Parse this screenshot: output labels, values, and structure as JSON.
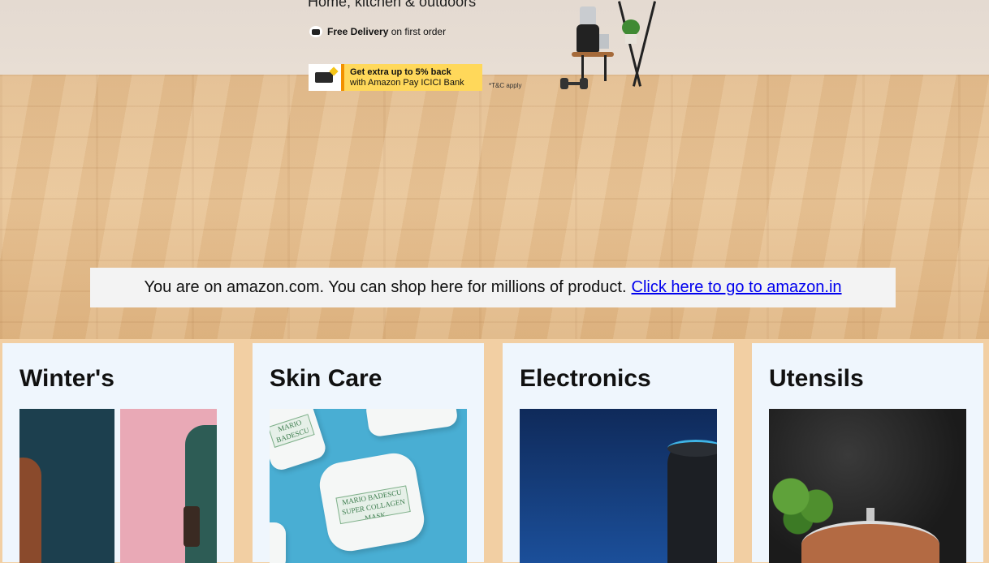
{
  "hero": {
    "subtitle": "Home, kitchen & outdoors",
    "delivery_bold": "Free Delivery",
    "delivery_rest": "on first order",
    "offer_line1": "Get extra up to 5% back",
    "offer_line2": "with Amazon Pay ICICI Bank",
    "tnc": "*T&C apply"
  },
  "notice": {
    "text": "You are on amazon.com. You can shop here for millions of product.",
    "link": "Click here to go to amazon.in"
  },
  "cards": [
    {
      "title": "Winter's",
      "image": "winter-fashion-image"
    },
    {
      "title": "Skin Care",
      "image": "skin-care-image"
    },
    {
      "title": "Electronics",
      "image": "smart-speaker-image"
    },
    {
      "title": "Utensils",
      "image": "cookware-image"
    }
  ],
  "skin_jar_label": "MARIO BADESCU SUPER COLLAGEN MASK",
  "colors": {
    "card_bg": "#eff6fd",
    "page_bg": "#f2cfa3",
    "link": "#0000ee",
    "offer_bg": "#ffd85a",
    "offer_accent": "#f29100"
  }
}
